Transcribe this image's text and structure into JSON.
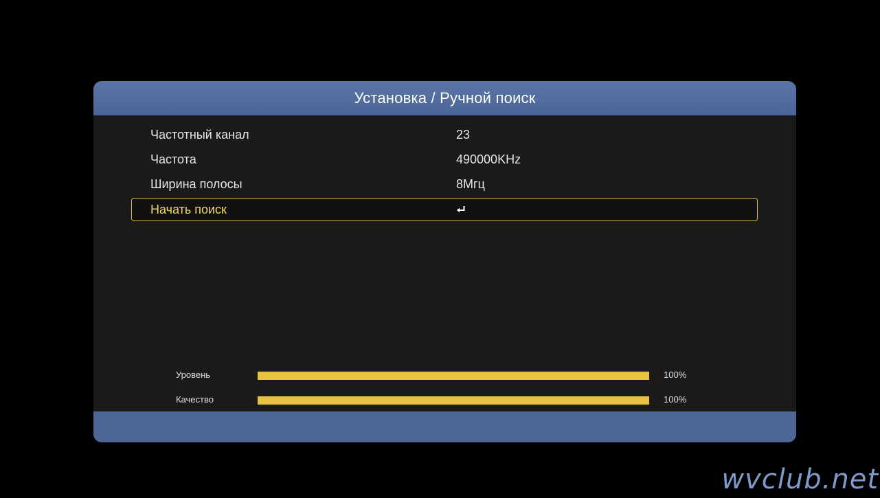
{
  "header": {
    "title": "Установка / Ручной поиск"
  },
  "menu": {
    "items": [
      {
        "label": "Частотный канал",
        "value": "23"
      },
      {
        "label": "Частота",
        "value": "490000KHz"
      },
      {
        "label": "Ширина полосы",
        "value": "8Мгц"
      },
      {
        "label": "Начать поиск",
        "value_icon": "enter-icon",
        "selected": true
      }
    ]
  },
  "signal": {
    "level": {
      "label": "Уровень",
      "value": "100%",
      "percent": 100
    },
    "quality": {
      "label": "Качество",
      "value": "100%",
      "percent": 100
    }
  },
  "watermark": "wvclub.net",
  "colors": {
    "header": "#4a6596",
    "footer": "#4c6796",
    "panel": "#1c1a19",
    "highlight": "#d8b94a",
    "bar": "#e8c33e",
    "watermark": "#7f99c9"
  }
}
